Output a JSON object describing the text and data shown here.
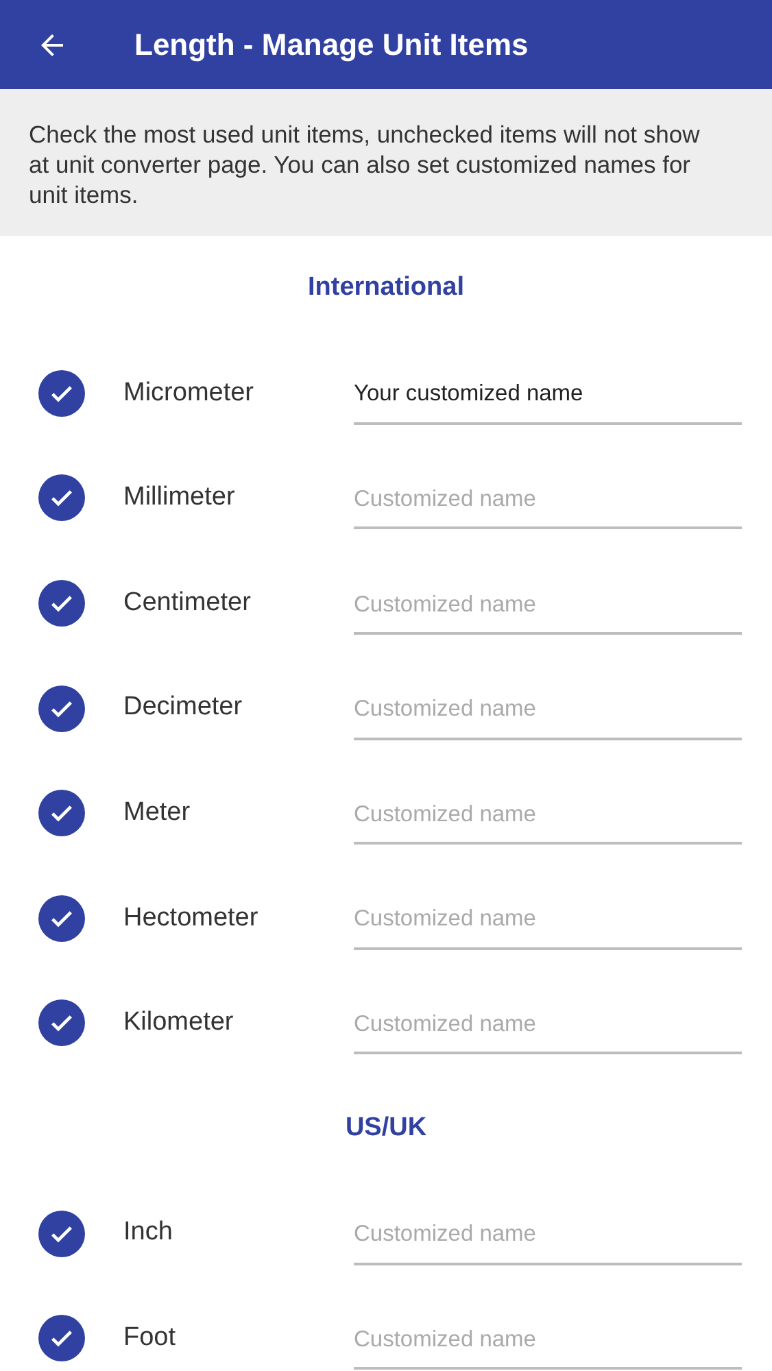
{
  "app_bar": {
    "title": "Length - Manage Unit Items"
  },
  "description": "Check the most used unit items, unchecked items will not show at unit converter page. You can also set customized names for unit items.",
  "sections": [
    {
      "heading": "International",
      "items": [
        {
          "name": "Micrometer",
          "checked": true,
          "value": "Your customized name"
        },
        {
          "name": "Millimeter",
          "checked": true,
          "placeholder": "Customized name"
        },
        {
          "name": "Centimeter",
          "checked": true,
          "placeholder": "Customized name"
        },
        {
          "name": "Decimeter",
          "checked": true,
          "placeholder": "Customized name"
        },
        {
          "name": "Meter",
          "checked": true,
          "placeholder": "Customized name"
        },
        {
          "name": "Hectometer",
          "checked": true,
          "placeholder": "Customized name"
        },
        {
          "name": "Kilometer",
          "checked": true,
          "placeholder": "Customized name"
        }
      ]
    },
    {
      "heading": "US/UK",
      "items": [
        {
          "name": "Inch",
          "checked": true,
          "placeholder": "Customized name"
        },
        {
          "name": "Foot",
          "checked": true,
          "placeholder": "Customized name"
        }
      ]
    }
  ]
}
